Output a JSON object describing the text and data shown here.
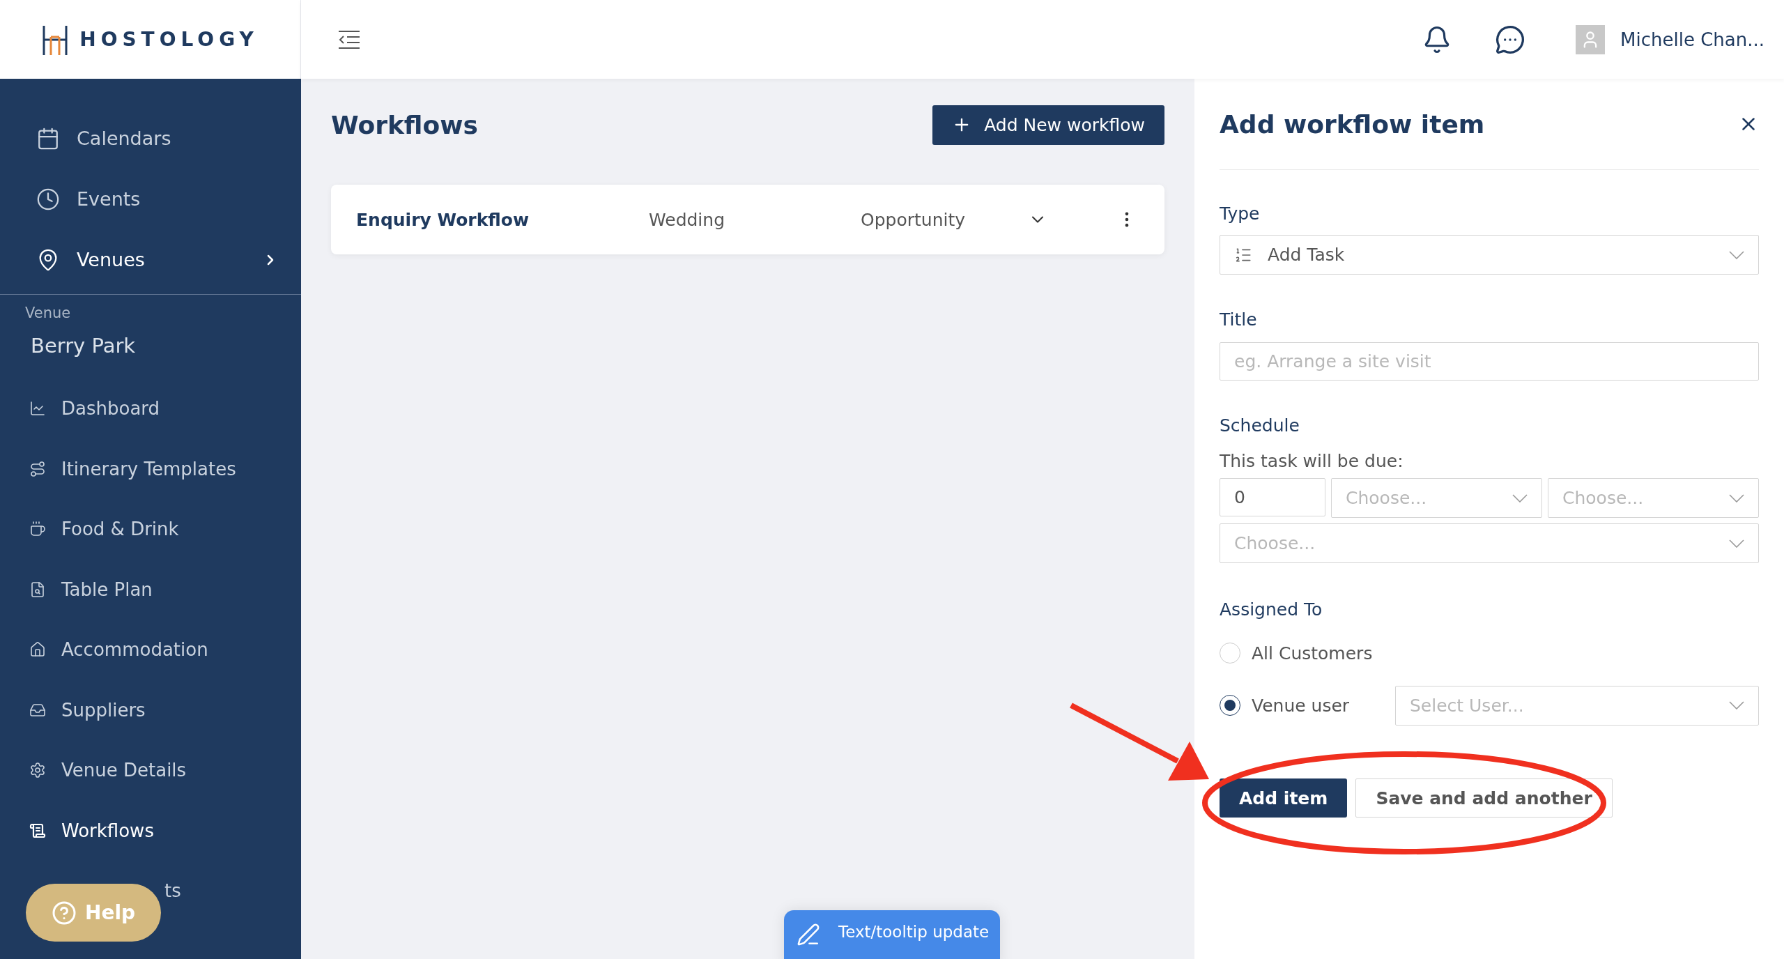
{
  "brand": {
    "name": "HOSTOLOGY"
  },
  "header": {
    "user_name": "Michelle Chan..."
  },
  "sidebar": {
    "top_items": [
      {
        "label": "Calendars",
        "selected": false
      },
      {
        "label": "Events",
        "selected": false
      },
      {
        "label": "Venues",
        "selected": true
      }
    ],
    "section_label": "Venue",
    "venue_name": "Berry Park",
    "venue_items": [
      {
        "label": "Dashboard",
        "selected": false
      },
      {
        "label": "Itinerary Templates",
        "selected": false
      },
      {
        "label": "Food & Drink",
        "selected": false
      },
      {
        "label": "Table Plan",
        "selected": false
      },
      {
        "label": "Accommodation",
        "selected": false
      },
      {
        "label": "Suppliers",
        "selected": false
      },
      {
        "label": "Venue Details",
        "selected": false
      },
      {
        "label": "Workflows",
        "selected": true
      },
      {
        "label": "ts",
        "selected": false
      }
    ]
  },
  "main": {
    "title": "Workflows",
    "add_button": "Add New workflow",
    "workflows": [
      {
        "name": "Enquiry Workflow",
        "event_type": "Wedding",
        "stage": "Opportunity"
      }
    ]
  },
  "panel": {
    "title": "Add workflow item",
    "type": {
      "label": "Type",
      "value": "Add Task"
    },
    "title_field": {
      "label": "Title",
      "placeholder": "eg. Arrange a site visit"
    },
    "schedule": {
      "label": "Schedule",
      "text": "This task will be due:",
      "amount": "0",
      "selects": [
        {
          "placeholder": "Choose..."
        },
        {
          "placeholder": "Choose..."
        },
        {
          "placeholder": "Choose..."
        }
      ]
    },
    "assigned": {
      "label": "Assigned To",
      "options": [
        {
          "label": "All Customers",
          "selected": false
        },
        {
          "label": "Venue user",
          "selected": true
        }
      ],
      "user_placeholder": "Select User..."
    },
    "buttons": {
      "primary": "Add item",
      "secondary": "Save and add another"
    }
  },
  "help": {
    "label": "Help"
  },
  "feedback": {
    "label": "Text/tooltip update"
  }
}
